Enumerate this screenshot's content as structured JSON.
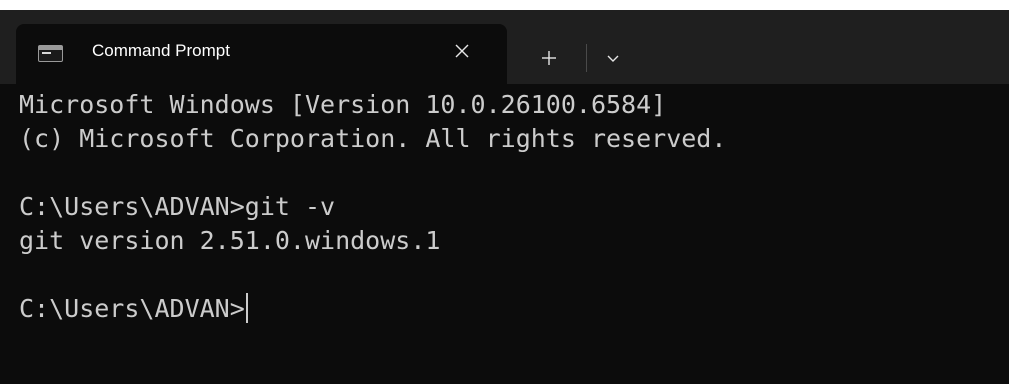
{
  "tab": {
    "title": "Command Prompt",
    "icon": "command-prompt-icon"
  },
  "tabbar": {
    "close_icon": "close-icon",
    "new_tab_icon": "plus-icon",
    "dropdown_icon": "chevron-down-icon"
  },
  "console": {
    "lines": [
      "Microsoft Windows [Version 10.0.26100.6584]",
      "(c) Microsoft Corporation. All rights reserved.",
      "",
      "C:\\Users\\ADVAN>git -v",
      "git version 2.51.0.windows.1",
      "",
      "C:\\Users\\ADVAN>"
    ]
  },
  "colors": {
    "background": "#0c0c0c",
    "titlebar": "#1f1f1f",
    "text": "#cccccc"
  }
}
